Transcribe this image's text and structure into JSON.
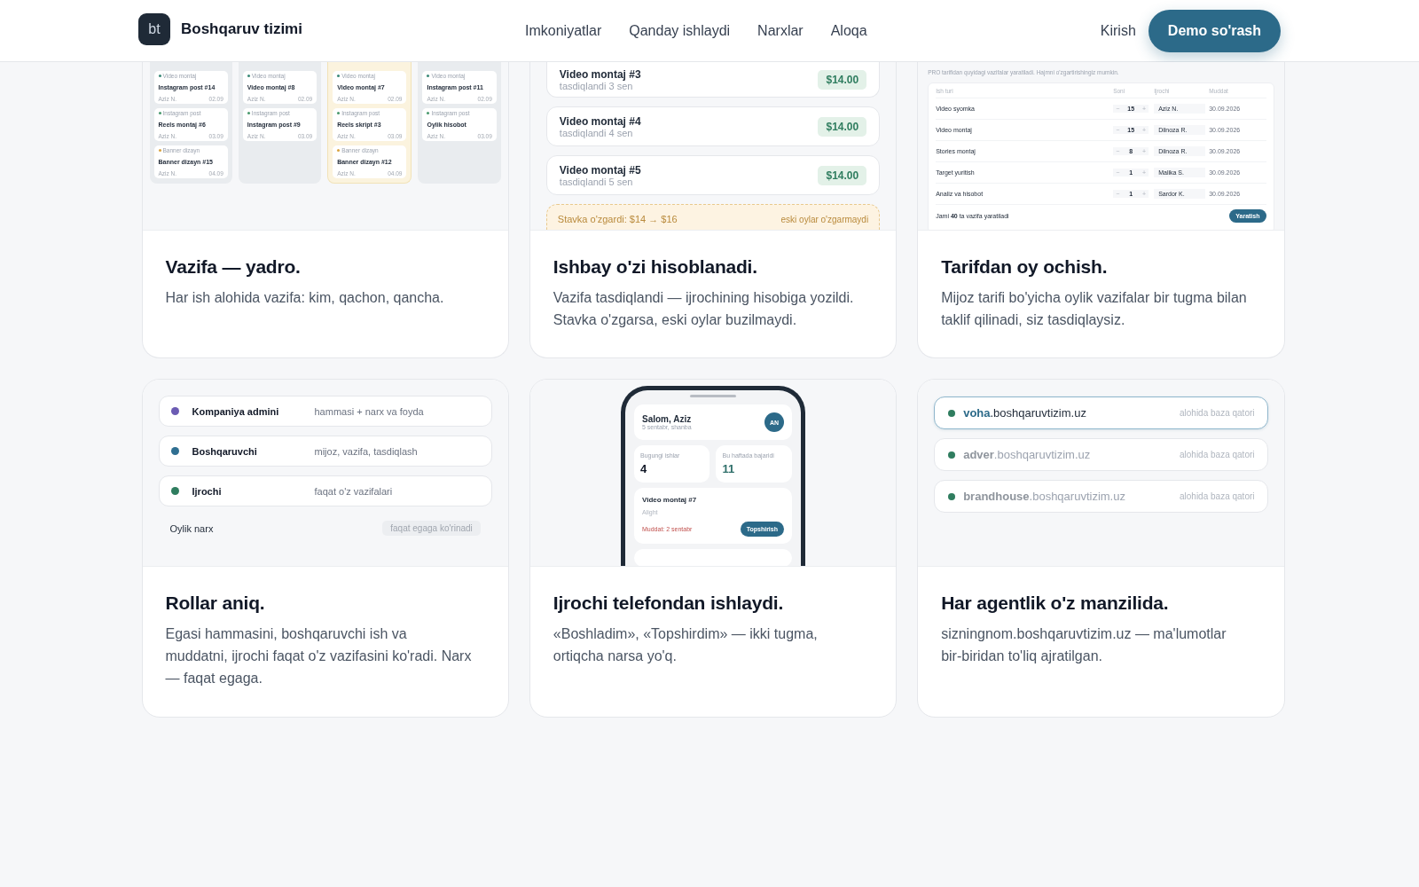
{
  "header": {
    "logo": "bt",
    "brand": "Boshqaruv tizimi",
    "nav": [
      "Imkoniyatlar",
      "Qanday ishlaydi",
      "Narxlar",
      "Aloqa"
    ],
    "login": "Kirish",
    "cta": "Demo so'rash"
  },
  "features": [
    {
      "kind": "kanban",
      "title": "Vazifa — yadro.",
      "text": "Har ish alohida vazifa: kim, qachon, qancha.",
      "columns": [
        {
          "selected": false,
          "cards": [
            {
              "category": "Video montaj",
              "color": "#3b8a78",
              "title": "Instagram post #14",
              "assignee": "Aziz N.",
              "date": "02.09"
            },
            {
              "category": "Instagram post",
              "color": "#4a9a6e",
              "title": "Reels montaj #6",
              "assignee": "Aziz N.",
              "date": "03.09"
            },
            {
              "category": "Banner dizayn",
              "color": "#d9a441",
              "title": "Banner dizayn #15",
              "assignee": "Aziz N.",
              "date": "04.09"
            }
          ]
        },
        {
          "selected": false,
          "cards": [
            {
              "category": "Video montaj",
              "color": "#3b8a78",
              "title": "Video montaj #8",
              "assignee": "Aziz N.",
              "date": "02.09"
            },
            {
              "category": "Instagram post",
              "color": "#4a9a6e",
              "title": "Instagram post #9",
              "assignee": "Aziz N.",
              "date": "03.09"
            }
          ]
        },
        {
          "selected": true,
          "cards": [
            {
              "category": "Video montaj",
              "color": "#3b8a78",
              "title": "Video montaj #7",
              "assignee": "Aziz N.",
              "date": "02.09"
            },
            {
              "category": "Instagram post",
              "color": "#4a9a6e",
              "title": "Reels skript #3",
              "assignee": "Aziz N.",
              "date": "03.09"
            },
            {
              "category": "Banner dizayn",
              "color": "#d9a441",
              "title": "Banner dizayn #12",
              "assignee": "Aziz N.",
              "date": "04.09"
            }
          ]
        },
        {
          "selected": false,
          "cards": [
            {
              "category": "Video montaj",
              "color": "#3b8a78",
              "title": "Instagram post #11",
              "assignee": "Aziz N.",
              "date": "02.09"
            },
            {
              "category": "Instagram post",
              "color": "#4a9a6e",
              "title": "Oylik hisobot",
              "assignee": "Aziz N.",
              "date": "03.09"
            }
          ]
        }
      ]
    },
    {
      "kind": "payouts",
      "title": "Ishbay o'zi hisoblanadi.",
      "text": "Vazifa tasdiqlandi — ijrochining hisobiga yozildi. Stavka o'zgarsa, eski oylar buzilmaydi.",
      "payouts": [
        {
          "title": "Video montaj #3",
          "note": "tasdiqlandi 3 sen",
          "amount": "$14.00"
        },
        {
          "title": "Video montaj #4",
          "note": "tasdiqlandi 4 sen",
          "amount": "$14.00"
        },
        {
          "title": "Video montaj #5",
          "note": "tasdiqlandi 5 sen",
          "amount": "$14.00"
        }
      ],
      "notice": {
        "text": "Stavka o'zgardi: $14 → $16",
        "note": "eski oylar o'zgarmaydi"
      }
    },
    {
      "kind": "plan",
      "title": "Tarifdan oy ochish.",
      "text": "Mijoz tarifi bo'yicha oylik vazifalar bir tugma bilan taklif qilinadi, siz tasdiqlaysiz.",
      "note": "PRO tarifidan quyidagi vazifalar yaratiladi. Hajmni o'zgartirishingiz mumkin.",
      "columns": [
        "Ish turi",
        "Soni",
        "Ijrochi",
        "Muddat"
      ],
      "rows": [
        {
          "type": "Video syomka",
          "minus": "−",
          "qty": "15",
          "plus": "+",
          "assignee": "Aziz N.",
          "due": "30.09.2026"
        },
        {
          "type": "Video montaj",
          "minus": "−",
          "qty": "15",
          "plus": "+",
          "assignee": "Dilnoza R.",
          "due": "30.09.2026"
        },
        {
          "type": "Stories montaj",
          "minus": "−",
          "qty": "8",
          "plus": "+",
          "assignee": "Dilnoza R.",
          "due": "30.09.2026"
        },
        {
          "type": "Target yuritish",
          "minus": "−",
          "qty": "1",
          "plus": "+",
          "assignee": "Malika S.",
          "due": "30.09.2026"
        },
        {
          "type": "Analiz va hisobot",
          "minus": "−",
          "qty": "1",
          "plus": "+",
          "assignee": "Sardor K.",
          "due": "30.09.2026"
        }
      ],
      "total": "Jami **40** ta vazifa yaratiladi",
      "button": "Yaratish"
    },
    {
      "kind": "roles",
      "title": "Rollar aniq.",
      "text": "Egasi hammasini, boshqaruvchi ish va muddatni, ijrochi faqat o'z vazifasini ko'radi. Narx — faqat egaga.",
      "roles": [
        {
          "name": "Kompaniya admini",
          "color": "#6b5bb3",
          "access": "hammasi + narx va foyda"
        },
        {
          "name": "Boshqaruvchi",
          "color": "#2f6f91",
          "access": "mijoz, vazifa, tasdiqlash"
        },
        {
          "name": "Ijrochi",
          "color": "#2f7d5f",
          "access": "faqat o'z vazifalari"
        }
      ],
      "price": {
        "label": "Oylik narx",
        "badge": "faqat egaga ko'rinadi"
      }
    },
    {
      "kind": "phone",
      "title": "Ijrochi telefondan ishlaydi.",
      "text": "«Boshladim», «Topshirdim» — ikki tugma, ortiqcha narsa yo'q.",
      "greeting": "Salom, Aziz",
      "date": "5 sentabr, shanba",
      "avatar": "AN",
      "stats": [
        {
          "label": "Bugungi ishlar",
          "value": "4"
        },
        {
          "label": "Bu haftada bajaridi",
          "value": "11"
        }
      ],
      "task": {
        "title": "Video montaj #7",
        "client": "Alight",
        "due": "Muddat: 2 sentabr",
        "button": "Topshirish"
      }
    },
    {
      "kind": "domains",
      "title": "Har agentlik o'z manzilida.",
      "text": "sizningnom.boshqaruvtizim.uz — ma'lumotlar bir-biridan to'liq ajratilgan.",
      "domains": [
        {
          "address": "**voha**.boshqaruvtizim.uz",
          "note": "alohida baza qatori",
          "color": "#2f7d5f",
          "selected": true
        },
        {
          "address": "**adver**.boshqaruvtizim.uz",
          "note": "alohida baza qatori",
          "color": "#2f7d5f",
          "selected": false
        },
        {
          "address": "**brandhouse**.boshqaruvtizim.uz",
          "note": "alohida baza qatori",
          "color": "#2f7d5f",
          "selected": false
        }
      ]
    }
  ]
}
